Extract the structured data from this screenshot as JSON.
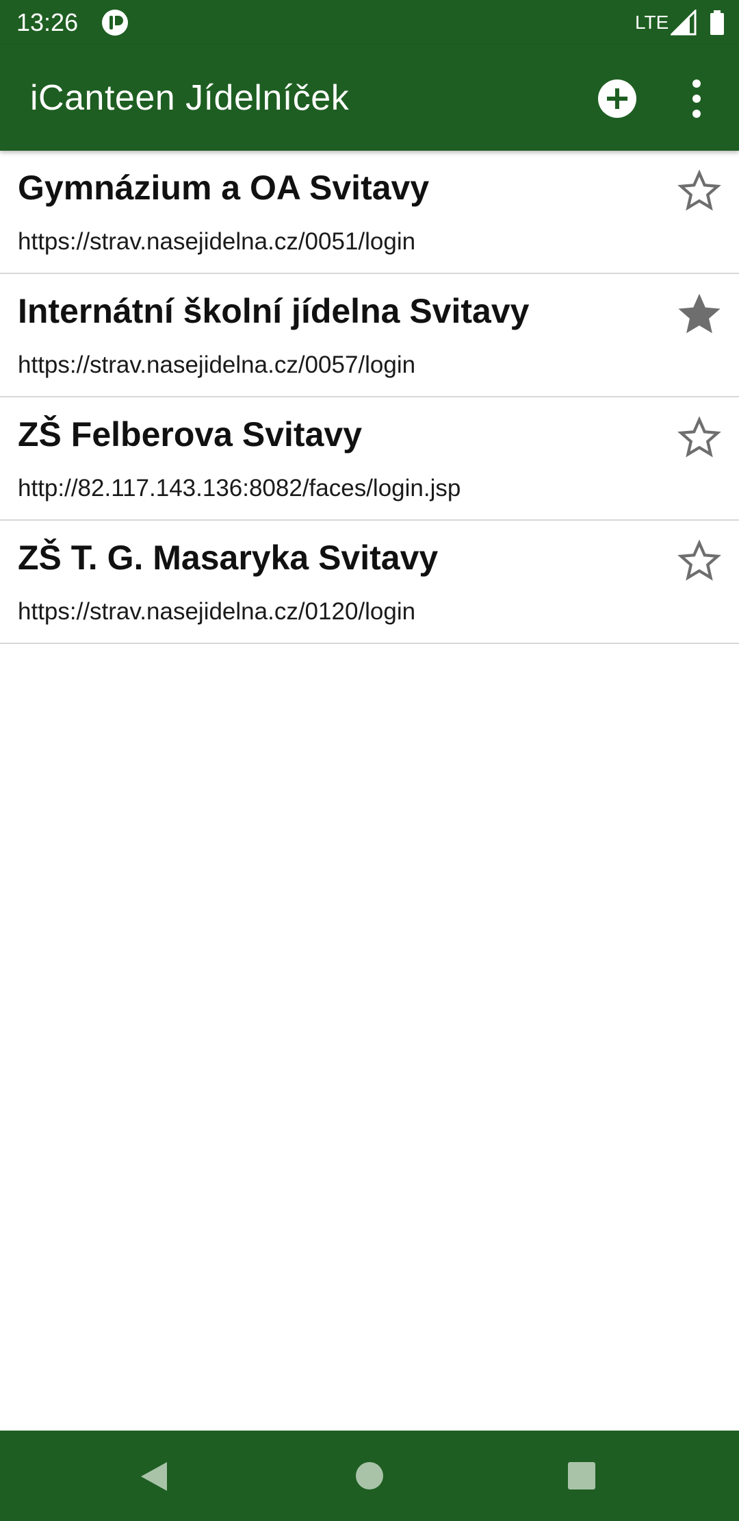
{
  "status_bar": {
    "time": "13:26",
    "network": "LTE",
    "icons": [
      "app-notification-icon",
      "signal-icon",
      "battery-icon"
    ]
  },
  "app_bar": {
    "title": "iCanteen Jídelníček",
    "actions": [
      "add-icon",
      "more-vert-icon"
    ]
  },
  "canteens": [
    {
      "name": "Gymnázium a OA Svitavy",
      "url": "https://strav.nasejidelna.cz/0051/login",
      "favorite": false
    },
    {
      "name": "Internátní školní jídelna Svitavy",
      "url": "https://strav.nasejidelna.cz/0057/login",
      "favorite": true
    },
    {
      "name": "ZŠ Felberova Svitavy",
      "url": "http://82.117.143.136:8082/faces/login.jsp",
      "favorite": false
    },
    {
      "name": "ZŠ T. G. Masaryka Svitavy",
      "url": "https://strav.nasejidelna.cz/0120/login",
      "favorite": false
    }
  ],
  "colors": {
    "primary": "#1e5e22",
    "on_primary": "#ffffff",
    "star": "#6e6e6e",
    "divider": "#d8d8d8"
  }
}
